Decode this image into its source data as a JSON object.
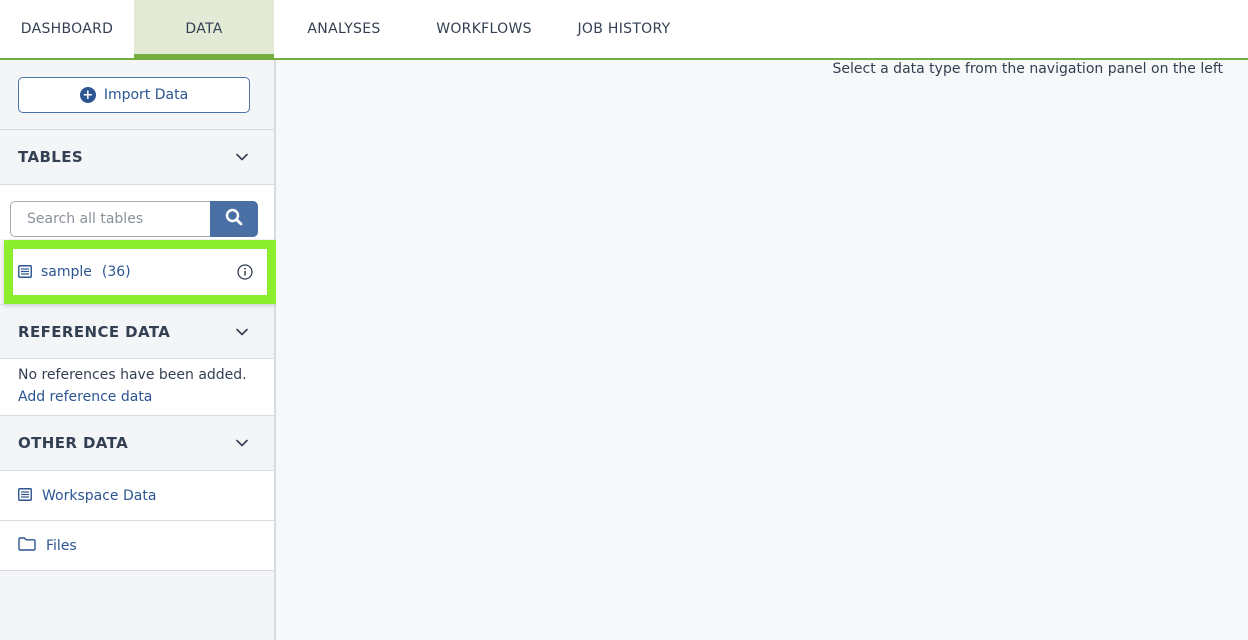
{
  "tabs": [
    {
      "label": "DASHBOARD",
      "active": false
    },
    {
      "label": "DATA",
      "active": true
    },
    {
      "label": "ANALYSES",
      "active": false
    },
    {
      "label": "WORKFLOWS",
      "active": false
    },
    {
      "label": "JOB HISTORY",
      "active": false
    }
  ],
  "sidebar": {
    "import_label": "Import Data",
    "tables": {
      "title": "TABLES",
      "search_placeholder": "Search all tables",
      "items": [
        {
          "label": "sample",
          "count": "(36)"
        }
      ]
    },
    "reference": {
      "title": "REFERENCE DATA",
      "empty_text": "No references have been added.",
      "add_link": "Add reference data"
    },
    "other": {
      "title": "OTHER DATA",
      "items": [
        {
          "label": "Workspace Data",
          "icon": "table-icon"
        },
        {
          "label": "Files",
          "icon": "folder-icon"
        }
      ]
    }
  },
  "main": {
    "hint": "Select a data type from the navigation panel on the left"
  },
  "colors": {
    "accent": "#74ae43",
    "link": "#2c5591",
    "highlight": "#8cee2f",
    "search_button": "#4a6fa5"
  }
}
